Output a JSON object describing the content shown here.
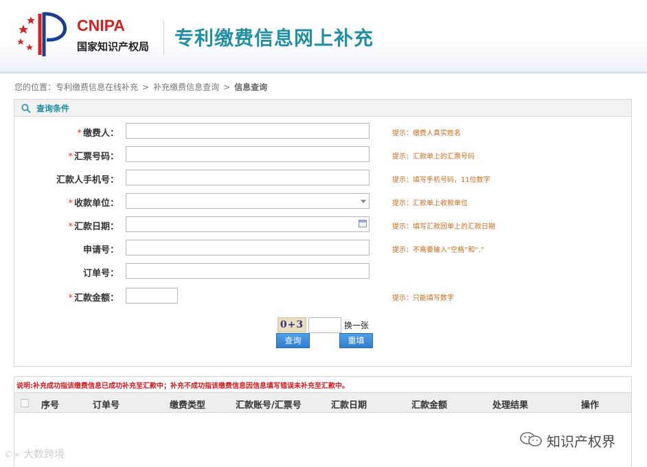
{
  "header": {
    "brand_en": "CNIPA",
    "brand_cn": "国家知识产权局",
    "site_title": "专利缴费信息网上补充",
    "colors": {
      "brand_red": "#d8201c",
      "title_teal": "#1f8fa3"
    }
  },
  "breadcrumb": {
    "prefix": "您的位置：",
    "items": [
      "专利缴费信息在线补充",
      "补充缴费信息查询",
      "信息查询"
    ],
    "separator": ">"
  },
  "query_panel": {
    "title": "查询条件",
    "fields": [
      {
        "label": "缴费人：",
        "required": true,
        "type": "text",
        "value": "",
        "hint": "提示：缴费人真实姓名"
      },
      {
        "label": "汇票号码：",
        "required": true,
        "type": "text",
        "value": "",
        "hint": "提示：汇款单上的汇票号码"
      },
      {
        "label": "汇款人手机号：",
        "required": false,
        "type": "text",
        "value": "",
        "hint": "提示：填写手机号码，11位数字"
      },
      {
        "label": "收款单位：",
        "required": true,
        "type": "select",
        "value": "",
        "hint": "提示：汇款单上收款单位"
      },
      {
        "label": "汇款日期：",
        "required": true,
        "type": "date",
        "value": "",
        "hint": "提示：填写汇款回单上的汇款日期"
      },
      {
        "label": "申请号：",
        "required": false,
        "type": "text",
        "value": "",
        "hint": "提示：不需要输入“空格”和“.”"
      },
      {
        "label": "订单号：",
        "required": false,
        "type": "text",
        "value": "",
        "hint": ""
      },
      {
        "label": "汇款金额：",
        "required": true,
        "type": "text",
        "value": "",
        "hint": "提示：只能填写数字"
      }
    ],
    "required_mark": "*",
    "captcha_text": "0+3",
    "captcha_value": "",
    "refresh_label": "换一张",
    "query_button": "查询",
    "reset_button": "重填",
    "colors": {
      "hint": "#c76b1c",
      "required": "#e4321c",
      "button": "#3a8ad8"
    }
  },
  "results": {
    "note": "说明:补充成功指该缴费信息已成功补充至汇款中；补充不成功指该缴费信息因信息填写错误未补充至汇款中。",
    "columns": [
      "序号",
      "订单号",
      "缴费类型",
      "汇款账号/汇票号",
      "汇款日期",
      "汇款金额",
      "处理结果",
      "操作"
    ],
    "rows": []
  },
  "watermarks": {
    "left": "大数跨境",
    "right": "知识产权界"
  }
}
